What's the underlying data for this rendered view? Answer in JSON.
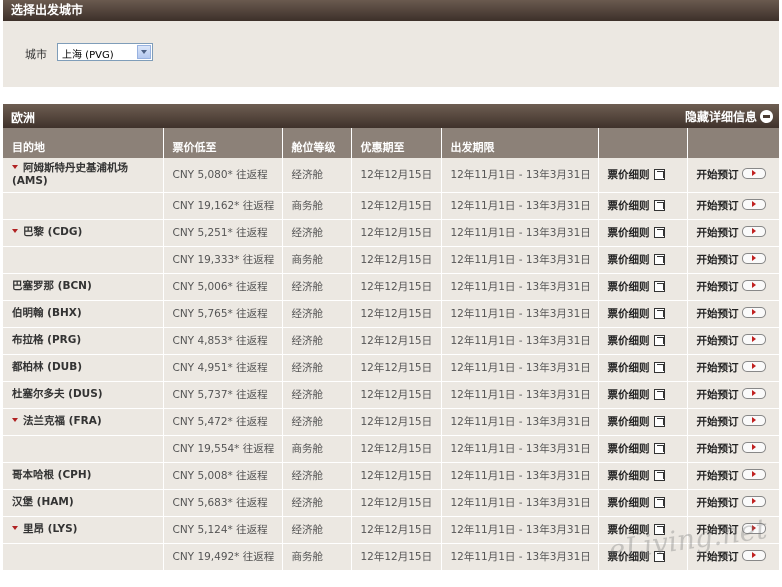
{
  "header": {
    "title": "选择出发城市"
  },
  "city": {
    "label": "城市",
    "selected": "上海 (PVG)"
  },
  "region": {
    "title": "欧洲",
    "toggle_label": "隐藏详细信息"
  },
  "table": {
    "columns": [
      "目的地",
      "票价低至",
      "舱位等级",
      "优惠期至",
      "出发期限",
      "",
      ""
    ],
    "rows": [
      {
        "dest": "阿姆斯特丹史基浦机场 (AMS)",
        "expandable": true,
        "price": "CNY 5,080* 往返程",
        "cabin": "经济舱",
        "until": "12年12月15日",
        "period": "12年11月1日 - 13年3月31日",
        "rules": "票价细则",
        "book": "开始预订"
      },
      {
        "dest": "",
        "expandable": false,
        "price": "CNY 19,162* 往返程",
        "cabin": "商务舱",
        "until": "12年12月15日",
        "period": "12年11月1日 - 13年3月31日",
        "rules": "票价细则",
        "book": "开始预订"
      },
      {
        "dest": "巴黎 (CDG)",
        "expandable": true,
        "price": "CNY 5,251* 往返程",
        "cabin": "经济舱",
        "until": "12年12月15日",
        "period": "12年11月1日 - 13年3月31日",
        "rules": "票价细则",
        "book": "开始预订"
      },
      {
        "dest": "",
        "expandable": false,
        "price": "CNY 19,333* 往返程",
        "cabin": "商务舱",
        "until": "12年12月15日",
        "period": "12年11月1日 - 13年3月31日",
        "rules": "票价细则",
        "book": "开始预订"
      },
      {
        "dest": "巴塞罗那 (BCN)",
        "expandable": false,
        "price": "CNY 5,006* 往返程",
        "cabin": "经济舱",
        "until": "12年12月15日",
        "period": "12年11月1日 - 13年3月31日",
        "rules": "票价细则",
        "book": "开始预订"
      },
      {
        "dest": "伯明翰 (BHX)",
        "expandable": false,
        "price": "CNY 5,765* 往返程",
        "cabin": "经济舱",
        "until": "12年12月15日",
        "period": "12年11月1日 - 13年3月31日",
        "rules": "票价细则",
        "book": "开始预订"
      },
      {
        "dest": "布拉格 (PRG)",
        "expandable": false,
        "price": "CNY 4,853* 往返程",
        "cabin": "经济舱",
        "until": "12年12月15日",
        "period": "12年11月1日 - 13年3月31日",
        "rules": "票价细则",
        "book": "开始预订"
      },
      {
        "dest": "都柏林 (DUB)",
        "expandable": false,
        "price": "CNY 4,951* 往返程",
        "cabin": "经济舱",
        "until": "12年12月15日",
        "period": "12年11月1日 - 13年3月31日",
        "rules": "票价细则",
        "book": "开始预订"
      },
      {
        "dest": "杜塞尔多夫 (DUS)",
        "expandable": false,
        "price": "CNY 5,737* 往返程",
        "cabin": "经济舱",
        "until": "12年12月15日",
        "period": "12年11月1日 - 13年3月31日",
        "rules": "票价细则",
        "book": "开始预订"
      },
      {
        "dest": "法兰克福 (FRA)",
        "expandable": true,
        "price": "CNY 5,472* 往返程",
        "cabin": "经济舱",
        "until": "12年12月15日",
        "period": "12年11月1日 - 13年3月31日",
        "rules": "票价细则",
        "book": "开始预订"
      },
      {
        "dest": "",
        "expandable": false,
        "price": "CNY 19,554* 往返程",
        "cabin": "商务舱",
        "until": "12年12月15日",
        "period": "12年11月1日 - 13年3月31日",
        "rules": "票价细则",
        "book": "开始预订"
      },
      {
        "dest": "哥本哈根 (CPH)",
        "expandable": false,
        "price": "CNY 5,008* 往返程",
        "cabin": "经济舱",
        "until": "12年12月15日",
        "period": "12年11月1日 - 13年3月31日",
        "rules": "票价细则",
        "book": "开始预订"
      },
      {
        "dest": "汉堡 (HAM)",
        "expandable": false,
        "price": "CNY 5,683* 往返程",
        "cabin": "经济舱",
        "until": "12年12月15日",
        "period": "12年11月1日 - 13年3月31日",
        "rules": "票价细则",
        "book": "开始预订"
      },
      {
        "dest": "里昂 (LYS)",
        "expandable": true,
        "price": "CNY 5,124* 往返程",
        "cabin": "经济舱",
        "until": "12年12月15日",
        "period": "12年11月1日 - 13年3月31日",
        "rules": "票价细则",
        "book": "开始预订"
      },
      {
        "dest": "",
        "expandable": false,
        "price": "CNY 19,492* 往返程",
        "cabin": "商务舱",
        "until": "12年12月15日",
        "period": "12年11月1日 - 13年3月31日",
        "rules": "票价细则",
        "book": "开始预订"
      }
    ]
  },
  "watermark": "eLiving.net"
}
